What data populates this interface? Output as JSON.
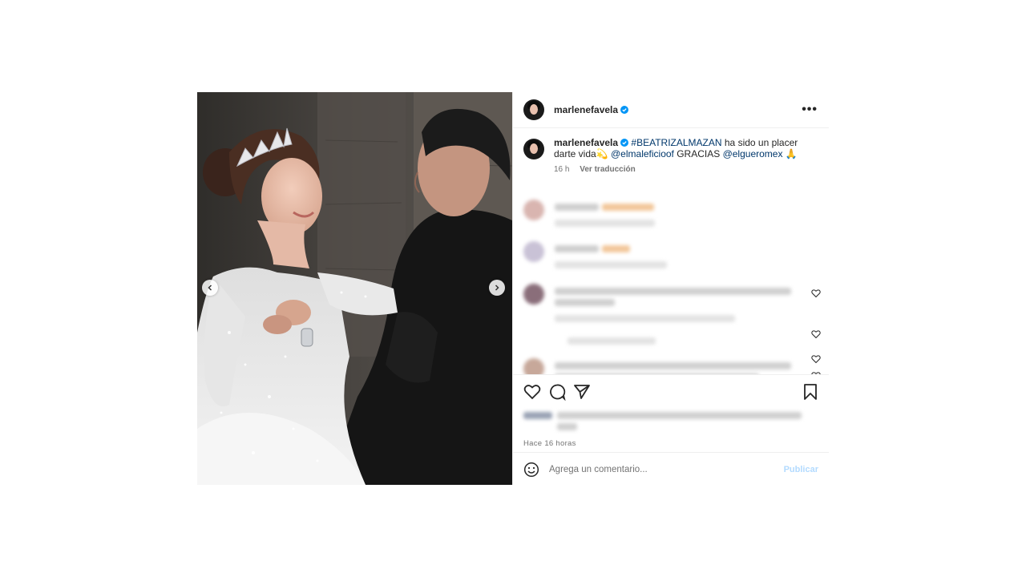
{
  "post": {
    "username": "marlenefavela",
    "verified_icon": "verified-badge-icon",
    "more_icon": "more-options-icon"
  },
  "caption": {
    "username": "marlenefavela",
    "hashtag": "#BEATRIZALMAZAN",
    "text_1": " ha sido un placer darte vida",
    "emoji_1": "💫",
    "mention_1": "@elmaleficioof",
    "text_2": " GRACIAS ",
    "mention_2": "@elgueromex",
    "emoji_2": "🙏",
    "time": "16 h",
    "translate": "Ver traducción"
  },
  "actions": {
    "like_icon": "heart-icon",
    "comment_icon": "comment-icon",
    "share_icon": "send-icon",
    "save_icon": "bookmark-icon"
  },
  "time_ago": "Hace 16 horas",
  "add_comment": {
    "emoji_icon": "emoji-icon",
    "placeholder": "Agrega un comentario...",
    "publish_label": "Publicar"
  },
  "colors": {
    "link": "#00376b",
    "verified": "#0095f6",
    "publish_disabled": "#b3dbff",
    "muted": "#737373"
  }
}
